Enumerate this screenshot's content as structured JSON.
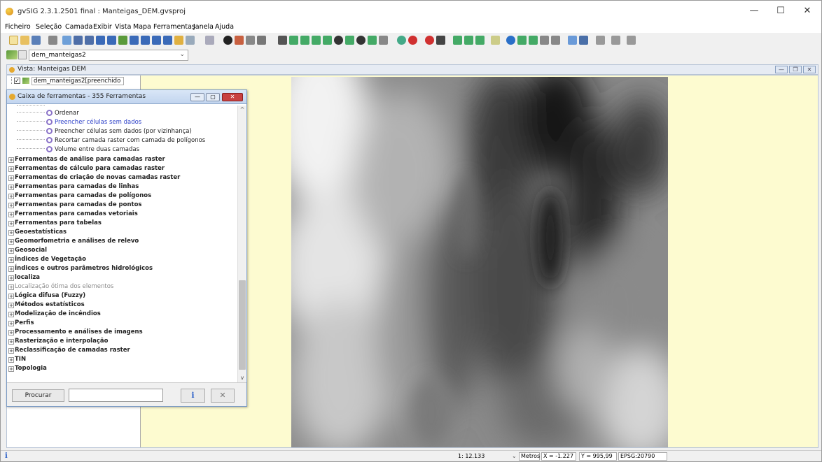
{
  "window": {
    "title": "gvSIG 2.3.1.2501 final : Manteigas_DEM.gvsproj",
    "minimize": "—",
    "maximize": "☐",
    "close": "✕"
  },
  "menu": [
    "Ficheiro",
    "Seleção",
    "Camada",
    "Exibir",
    "Vista",
    "Mapa",
    "Ferramentas",
    "Janela",
    "Ajuda"
  ],
  "layer_selector": {
    "value": "dem_manteigas2"
  },
  "view": {
    "title": "Vista: Manteigas DEM",
    "toc_layer": "dem_manteigas2[preenchido"
  },
  "toolbox": {
    "title": "Caixa de ferramentas - 355 Ferramentas",
    "search_button": "Procurar",
    "search_value": "",
    "info_button": "i",
    "tools_button": "✕",
    "leaf_items": [
      {
        "label": "Ordenar",
        "link": false
      },
      {
        "label": "Preencher células sem dados",
        "link": true
      },
      {
        "label": "Preencher células sem dados (por vizinhança)",
        "link": false
      },
      {
        "label": "Recortar camada raster com camada de polígonos",
        "link": false
      },
      {
        "label": "Volume entre duas camadas",
        "link": false
      }
    ],
    "categories": [
      {
        "label": "Ferramentas de análise para camadas raster",
        "muted": false
      },
      {
        "label": "Ferramentas de cálculo para camadas raster",
        "muted": false
      },
      {
        "label": "Ferramentas de criação de novas camadas raster",
        "muted": false
      },
      {
        "label": "Ferramentas para camadas de linhas",
        "muted": false
      },
      {
        "label": "Ferramentas para camadas de polígonos",
        "muted": false
      },
      {
        "label": "Ferramentas para camadas de pontos",
        "muted": false
      },
      {
        "label": "Ferramentas para camadas vetoriais",
        "muted": false
      },
      {
        "label": "Ferramentas para tabelas",
        "muted": false
      },
      {
        "label": "Geoestatísticas",
        "muted": false
      },
      {
        "label": "Geomorfometria e análises de relevo",
        "muted": false
      },
      {
        "label": "Geosocial",
        "muted": false
      },
      {
        "label": "Índices de Vegetação",
        "muted": false
      },
      {
        "label": "Índices e outros parâmetros hidrológicos",
        "muted": false
      },
      {
        "label": "localiza",
        "muted": false
      },
      {
        "label": "Localização ótima dos elementos",
        "muted": true
      },
      {
        "label": "Lógica difusa (Fuzzy)",
        "muted": false
      },
      {
        "label": "Métodos estatísticos",
        "muted": false
      },
      {
        "label": "Modelização de incêndios",
        "muted": false
      },
      {
        "label": "Perfis",
        "muted": false
      },
      {
        "label": "Processamento e análises de imagens",
        "muted": false
      },
      {
        "label": "Rasterização e interpolação",
        "muted": false
      },
      {
        "label": "Reclassificação de camadas raster",
        "muted": false
      },
      {
        "label": "TIN",
        "muted": false
      },
      {
        "label": "Topologia",
        "muted": false
      }
    ]
  },
  "status": {
    "info_icon": "i",
    "scale": "1: 12.133",
    "units": "Metros",
    "x": "X = -1.227",
    "y": "Y = 995,99",
    "epsg": "EPSG:20790"
  },
  "colors": {
    "view_background": "#fdfbd0",
    "link_text": "#2a3ec8",
    "title_blue": "#c2d5ef"
  }
}
